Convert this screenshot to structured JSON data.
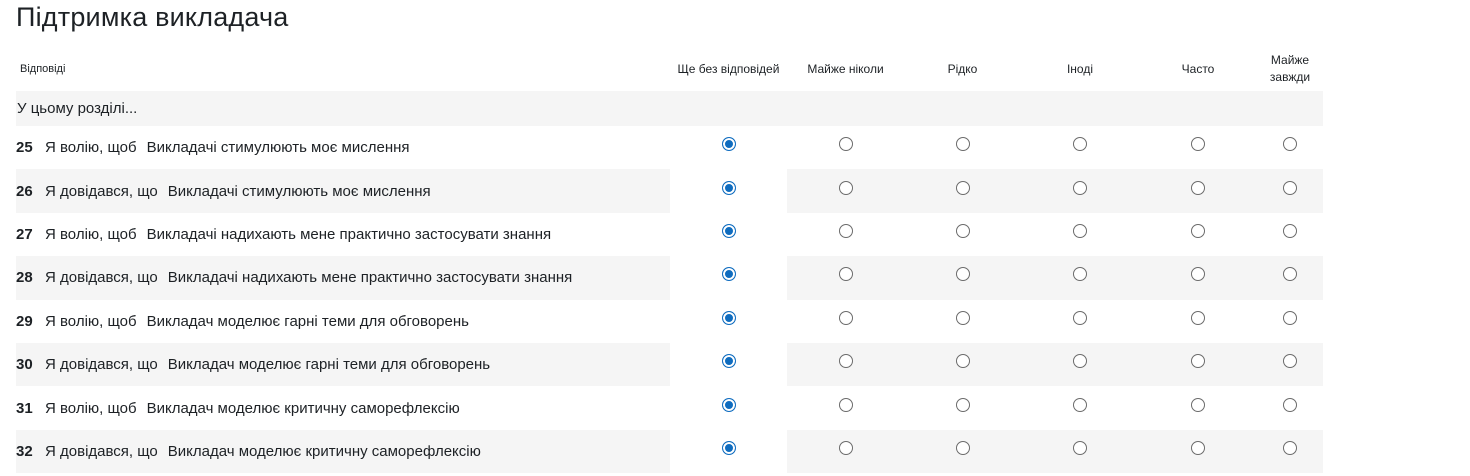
{
  "page_title": "Підтримка викладача",
  "table": {
    "question_header": "Відповіді",
    "columns": [
      "Ще без відповідей",
      "Майже ніколи",
      "Рідко",
      "Іноді",
      "Часто",
      "Майже завжди"
    ],
    "section_label": "У цьому розділі...",
    "rows": [
      {
        "num": "25",
        "prefix": "Я волію, щоб",
        "text": "Викладачі стимулюють моє мислення",
        "selected": 0
      },
      {
        "num": "26",
        "prefix": "Я довідався, що",
        "text": "Викладачі стимулюють моє мислення",
        "selected": 0
      },
      {
        "num": "27",
        "prefix": "Я волію, щоб",
        "text": "Викладачі надихають мене практично застосувати знання",
        "selected": 0
      },
      {
        "num": "28",
        "prefix": "Я довідався, що",
        "text": "Викладачі надихають мене практично застосувати знання",
        "selected": 0
      },
      {
        "num": "29",
        "prefix": "Я волію, щоб",
        "text": "Викладач моделює гарні теми для обговорень",
        "selected": 0
      },
      {
        "num": "30",
        "prefix": "Я довідався, що",
        "text": "Викладач моделює гарні теми для обговорень",
        "selected": 0
      },
      {
        "num": "31",
        "prefix": "Я волію, щоб",
        "text": "Викладач моделює критичну саморефлексію",
        "selected": 0
      },
      {
        "num": "32",
        "prefix": "Я довідався, що",
        "text": "Викладач моделює критичну саморефлексію",
        "selected": 0
      }
    ]
  },
  "colors": {
    "accent": "#0f6cbf",
    "row_shade": "#f5f5f5",
    "text": "#1d2125"
  }
}
